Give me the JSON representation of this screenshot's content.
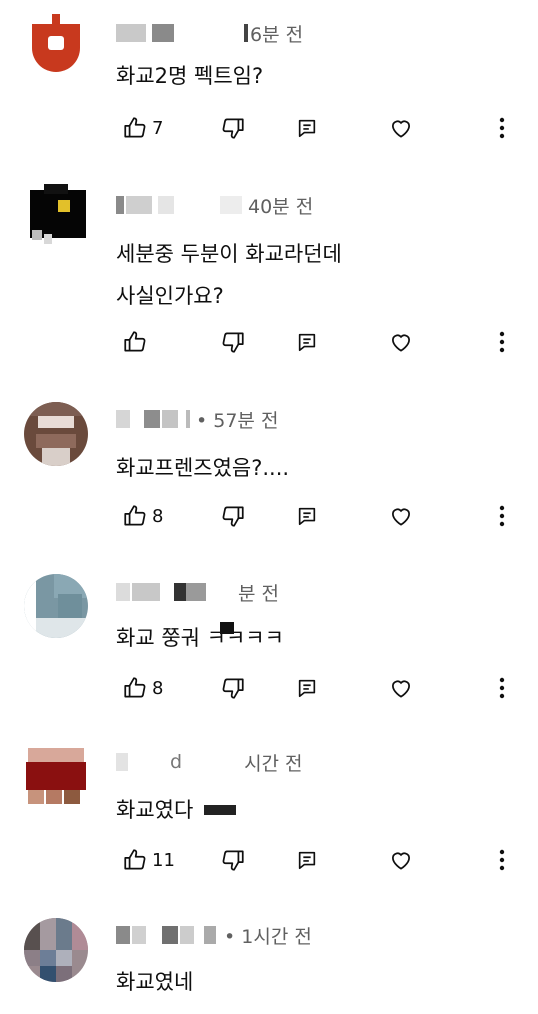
{
  "comments": [
    {
      "meta": "6분 전",
      "lines": [
        "화교2명 펙트임?"
      ],
      "likes": "7"
    },
    {
      "meta": "40분 전",
      "lines": [
        "세분중 두분이 화교라던데",
        "사실인가요?"
      ],
      "likes": ""
    },
    {
      "meta": "• 57분 전",
      "lines": [
        "화교프렌즈였음?...."
      ],
      "likes": "8"
    },
    {
      "meta": "분 전",
      "lines": [
        "화교 쭝궈   ㅋㅋㅋㅋ"
      ],
      "likes": "8"
    },
    {
      "meta": "시간 전",
      "lines": [
        "화교였다"
      ],
      "likes": "11"
    },
    {
      "meta": "• 1시간 전",
      "lines": [
        "화교였네"
      ],
      "likes": ""
    }
  ],
  "icons": {
    "like": "thumb-up-icon",
    "dislike": "thumb-down-icon",
    "reply": "reply-icon",
    "heart": "heart-icon",
    "more": "more-vert-icon"
  },
  "colors": {
    "text": "#0f0f0f",
    "meta": "#606060",
    "icon": "#0f0f0f"
  }
}
